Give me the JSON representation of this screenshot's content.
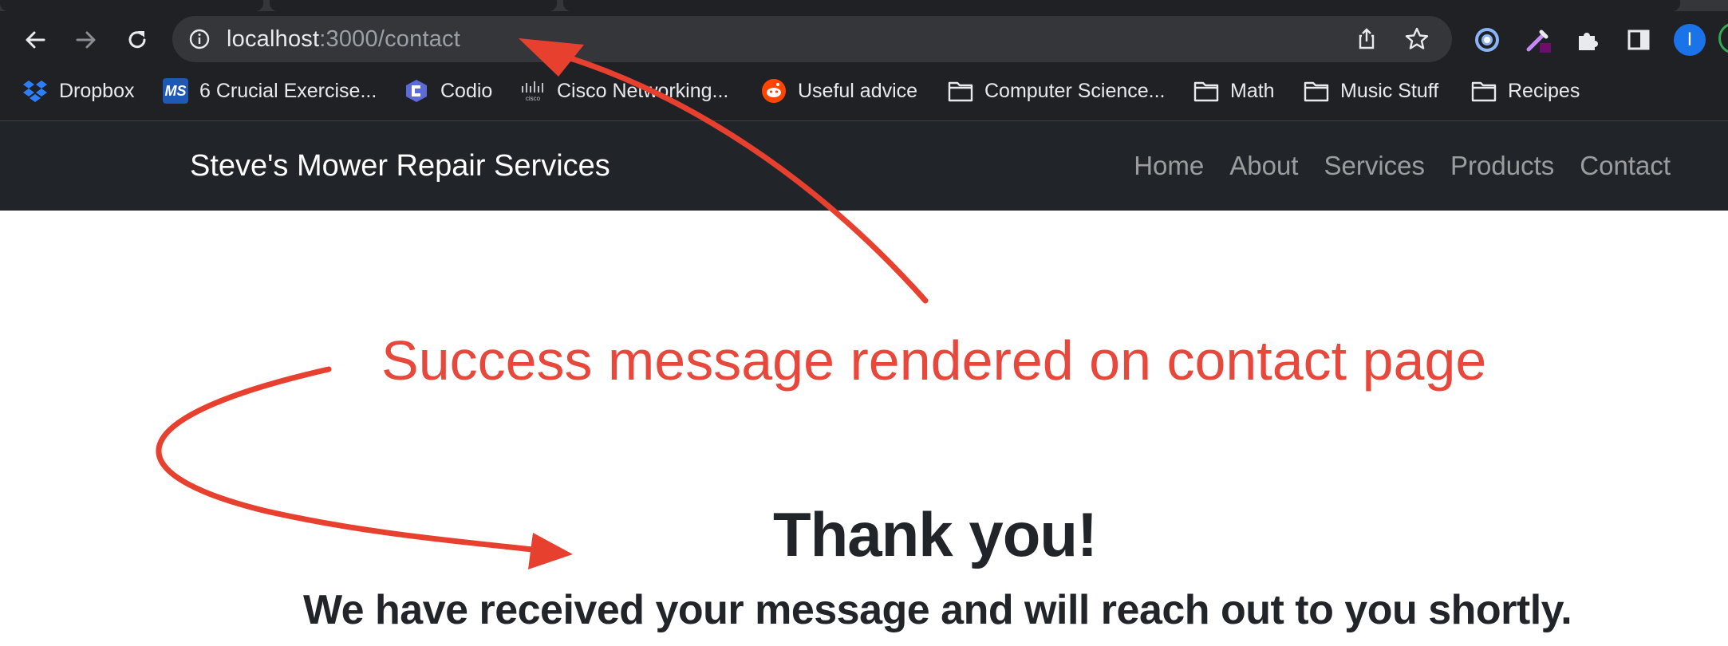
{
  "browser": {
    "url_host": "localhost",
    "url_path": ":3000/contact",
    "profile_initial": "I"
  },
  "bookmarks": [
    {
      "label": "Dropbox",
      "icon": "dropbox-icon"
    },
    {
      "label": "6 Crucial Exercise...",
      "icon": "ms-icon"
    },
    {
      "label": "Codio",
      "icon": "codio-icon"
    },
    {
      "label": "Cisco Networking...",
      "icon": "cisco-icon"
    },
    {
      "label": "Useful advice",
      "icon": "reddit-icon"
    },
    {
      "label": "Computer Science...",
      "icon": "folder-icon"
    },
    {
      "label": "Math",
      "icon": "folder-icon"
    },
    {
      "label": "Music Stuff",
      "icon": "folder-icon"
    },
    {
      "label": "Recipes",
      "icon": "folder-icon"
    }
  ],
  "site": {
    "brand": "Steve's Mower Repair Services",
    "nav": [
      "Home",
      "About",
      "Services",
      "Products",
      "Contact"
    ]
  },
  "annotation": {
    "text": "Success message rendered on contact page",
    "color": "#e8473c"
  },
  "content": {
    "heading": "Thank you!",
    "message": "We have received your message and will reach out to you shortly."
  },
  "colors": {
    "chrome_bg": "#202124",
    "omnibox_bg": "#35363a",
    "navbar_bg": "#212529",
    "text_dark": "#212529"
  }
}
